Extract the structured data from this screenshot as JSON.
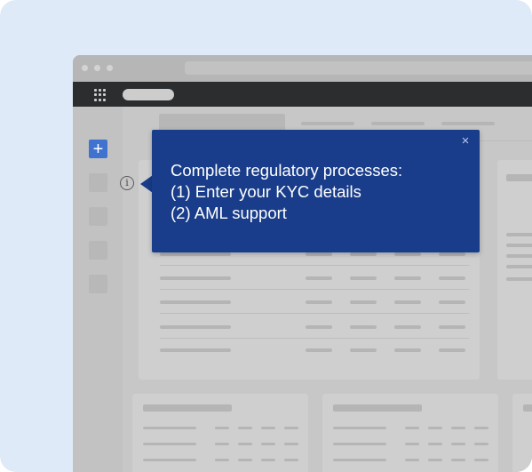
{
  "tooltip": {
    "lines": [
      "Complete regulatory processes:",
      "(1) Enter your KYC details",
      "(2) AML support"
    ],
    "close_glyph": "×"
  },
  "sidebar": {
    "add_glyph": "+"
  },
  "info_glyph": "i",
  "icons": {
    "apps": "grid-icon",
    "add": "plus-icon",
    "info": "info-icon",
    "close": "close-icon"
  },
  "colors": {
    "background": "#deeaf8",
    "tooltip": "#193d8a",
    "accent": "#3f73cf",
    "appbar": "#2b2d2f"
  }
}
